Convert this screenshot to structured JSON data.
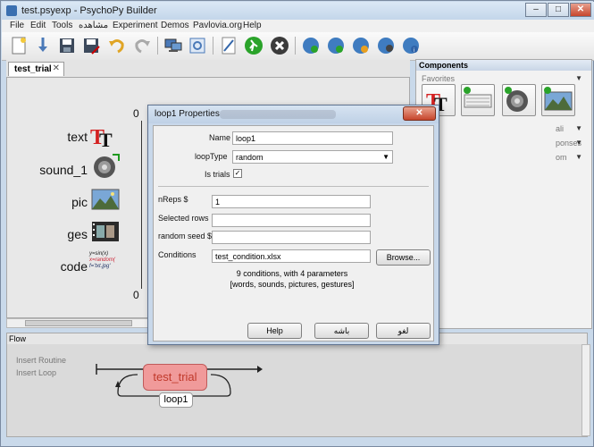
{
  "window": {
    "title": "test.psyexp - PsychoPy Builder",
    "controls": [
      "–",
      "□",
      "✕"
    ]
  },
  "menu": [
    "File",
    "Edit",
    "Tools",
    "مشاهده",
    "Experiment",
    "Demos",
    "Pavlovia.org",
    "Help"
  ],
  "toolbar": {
    "icons": [
      "new-file-icon",
      "open-icon",
      "save-icon",
      "save-as-icon",
      "undo-icon",
      "redo-icon",
      "monitor-icon",
      "experiment-settings-icon",
      "compile-script-icon",
      "run-icon",
      "stop-icon",
      "pavlovia-sync-icon",
      "pavlovia-search-icon",
      "pavlovia-project-icon",
      "pavlovia-user-icon",
      "pavlovia-info-icon"
    ]
  },
  "routine": {
    "tab_label": "test_trial",
    "tab_close": "✕",
    "axis_zero_top": "0",
    "axis_zero_bottom": "0",
    "components": [
      {
        "label": "text",
        "icon": "text-component-icon"
      },
      {
        "label": "sound_1",
        "icon": "sound-component-icon"
      },
      {
        "label": "pic",
        "icon": "image-component-icon"
      },
      {
        "label": "ges",
        "icon": "movie-component-icon"
      },
      {
        "label": "code",
        "icon": "code-component-icon"
      }
    ],
    "code_icon_lines": [
      "y=sin(x)",
      "x=random(",
      "f='txt.jpg'"
    ]
  },
  "components_panel": {
    "title": "Components",
    "categories": [
      "Favorites",
      "ali",
      "ponses",
      "om"
    ],
    "favorites": [
      "text-component-icon",
      "keyboard-component-icon",
      "sound-component-icon",
      "image-component-icon"
    ]
  },
  "flow": {
    "title": "Flow",
    "insert_routine": "Insert Routine",
    "insert_loop": "Insert Loop",
    "routine_name": "test_trial",
    "loop_name": "loop1"
  },
  "dialog": {
    "title": "loop1 Properties",
    "close": "✕",
    "name_label": "Name",
    "name_value": "loop1",
    "looptype_label": "loopType",
    "looptype_value": "random",
    "istrials_label": "Is trials",
    "istrials_checked": "✓",
    "nreps_label": "nReps $",
    "nreps_value": "1",
    "selected_rows_label": "Selected rows",
    "selected_rows_value": "",
    "random_seed_label": "random seed $",
    "random_seed_value": "",
    "conditions_label": "Conditions",
    "conditions_value": "test_condition.xlsx",
    "browse_label": "Browse...",
    "info_line1": "9 conditions, with 4 parameters",
    "info_line2": "[words, sounds, pictures, gestures]",
    "help_label": "Help",
    "ok_label": "باشه",
    "cancel_label": "لغو"
  }
}
